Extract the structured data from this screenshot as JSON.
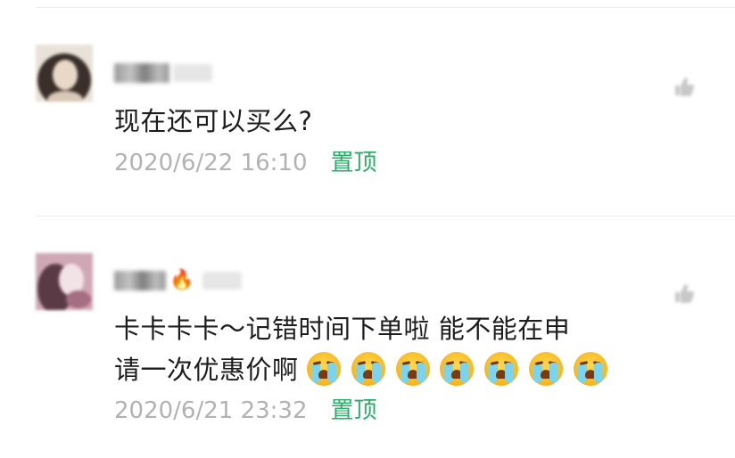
{
  "comments": [
    {
      "author_name": "",
      "text": "现在还可以买么?",
      "time": "2020/6/22 16:10",
      "pin_label": "置顶",
      "avatar_icon": "user-avatar",
      "like_icon": "like-icon"
    },
    {
      "author_name": "",
      "text_line1": "卡卡卡卡～记错时间下单啦 能不能在申",
      "text_line2": "请一次优惠价啊",
      "emojis": [
        "crying-emoji",
        "crying-emoji",
        "crying-emoji",
        "crying-emoji",
        "crying-emoji",
        "crying-emoji",
        "crying-emoji"
      ],
      "time": "2020/6/21 23:32",
      "pin_label": "置顶",
      "avatar_icon": "user-avatar",
      "name_badge_icon": "fire-icon",
      "like_icon": "like-icon"
    }
  ],
  "colors": {
    "pin_green": "#2aae67",
    "meta_gray": "#b2b2b2",
    "text_dark": "#1d1d1d",
    "divider": "#ededed"
  }
}
